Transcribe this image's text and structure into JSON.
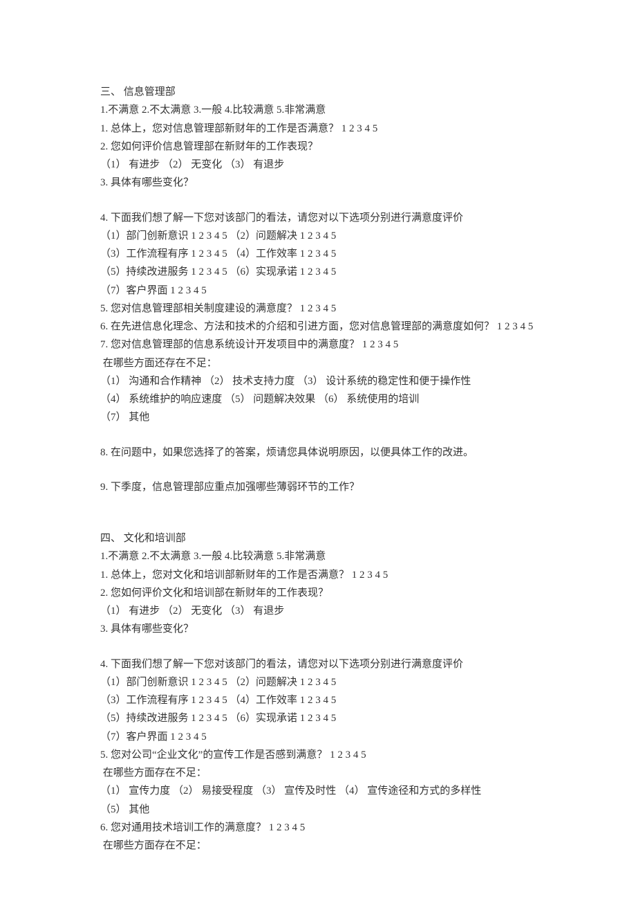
{
  "section3": {
    "title": "三、 信息管理部",
    "scale": "1.不满意 2.不太满意 3.一般 4.比较满意 5.非常满意",
    "q1": "1. 总体上，您对信息管理部新财年的工作是否满意？ 1 2 3 4 5",
    "q2": "2. 您如何评价信息管理部在新财年的工作表现？",
    "q2_options": "（1） 有进步 （2） 无变化 （3） 有退步",
    "q3": "3. 具体有哪些变化？",
    "q4": "4. 下面我们想了解一下您对该部门的看法，请您对以下选项分别进行满意度评价",
    "q4_line1": "（1）部门创新意识 1 2 3 4 5 （2）问题解决 1 2 3 4 5",
    "q4_line2": "（3）工作流程有序 1 2 3 4 5 （4）工作效率 1 2 3 4 5",
    "q4_line3": "（5）持续改进服务 1 2 3 4 5 （6）实现承诺 1 2 3 4 5",
    "q4_line4": "（7）客户界面 1 2 3 4 5",
    "q5": "5. 您对信息管理部相关制度建设的满意度？ 1 2 3 4 5",
    "q6": "6. 在先进信息化理念、方法和技术的介绍和引进方面，您对信息管理部的满意度如何？ 1 2 3 4 5",
    "q7": "7. 您对信息管理部的信息系统设计开发项目中的满意度？ 1 2 3 4 5",
    "q7_deficit": " 在哪些方面还存在不足：",
    "q7_line1": "（1） 沟通和合作精神 （2） 技术支持力度 （3） 设计系统的稳定性和便于操作性",
    "q7_line2": "（4） 系统维护的响应速度 （5） 问题解决效果 （6） 系统使用的培训",
    "q7_line3": "（7） 其他",
    "q8": "8. 在问题中，如果您选择了的答案，烦请您具体说明原因，以便具体工作的改进。",
    "q9": "9. 下季度，信息管理部应重点加强哪些薄弱环节的工作？"
  },
  "section4": {
    "title": "四、 文化和培训部",
    "scale": "1.不满意 2.不太满意 3.一般 4.比较满意 5.非常满意",
    "q1": "1. 总体上，您对文化和培训部新财年的工作是否满意？ 1 2 3 4 5",
    "q2": "2. 您如何评价文化和培训部在新财年的工作表现？",
    "q2_options": "（1） 有进步 （2） 无变化 （3） 有退步",
    "q3": "3. 具体有哪些变化？",
    "q4": "4. 下面我们想了解一下您对该部门的看法，请您对以下选项分别进行满意度评价",
    "q4_line1": "（1）部门创新意识 1 2 3 4 5 （2）问题解决 1 2 3 4 5",
    "q4_line2": "（3）工作流程有序 1 2 3 4 5 （4）工作效率 1 2 3 4 5",
    "q4_line3": "（5）持续改进服务 1 2 3 4 5 （6）实现承诺 1 2 3 4 5",
    "q4_line4": "（7）客户界面 1 2 3 4 5",
    "q5": "5. 您对公司“企业文化”的宣传工作是否感到满意？ 1 2 3 4 5",
    "q5_deficit": " 在哪些方面存在不足：",
    "q5_line1": "（1） 宣传力度 （2） 易接受程度 （3） 宣传及时性 （4） 宣传途径和方式的多样性",
    "q5_line2": "（5） 其他",
    "q6": "6. 您对通用技术培训工作的满意度？ 1 2 3 4 5",
    "q6_deficit": " 在哪些方面存在不足："
  }
}
